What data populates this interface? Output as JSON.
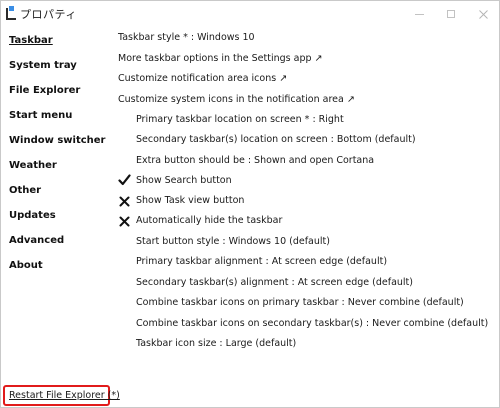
{
  "window": {
    "title": "プロパティ"
  },
  "sidebar": {
    "items": [
      {
        "label": "Taskbar",
        "active": true
      },
      {
        "label": "System tray"
      },
      {
        "label": "File Explorer"
      },
      {
        "label": "Start menu"
      },
      {
        "label": "Window switcher"
      },
      {
        "label": "Weather"
      },
      {
        "label": "Other"
      },
      {
        "label": "Updates"
      },
      {
        "label": "Advanced"
      },
      {
        "label": "About"
      }
    ],
    "restart_label": "Restart File Explorer (*)"
  },
  "settings": [
    {
      "label": "Taskbar style * : Windows 10",
      "kind": "option"
    },
    {
      "label": "More taskbar options in the Settings app ↗",
      "kind": "link"
    },
    {
      "label": "Customize notification area icons ↗",
      "kind": "link"
    },
    {
      "label": "Customize system icons in the notification area ↗",
      "kind": "link"
    },
    {
      "label": "Primary taskbar location on screen * : Right",
      "kind": "option"
    },
    {
      "label": "Secondary taskbar(s) location on screen : Bottom (default)",
      "kind": "option"
    },
    {
      "label": "Extra button should be : Shown and open Cortana",
      "kind": "option"
    },
    {
      "label": "Show Search button",
      "kind": "checkbox",
      "state": "checked"
    },
    {
      "label": "Show Task view button",
      "kind": "checkbox",
      "state": "unchecked"
    },
    {
      "label": "Automatically hide the taskbar",
      "kind": "checkbox",
      "state": "unchecked"
    },
    {
      "label": "Start button style : Windows 10 (default)",
      "kind": "option"
    },
    {
      "label": "Primary taskbar alignment : At screen edge (default)",
      "kind": "option"
    },
    {
      "label": "Secondary taskbar(s) alignment : At screen edge (default)",
      "kind": "option"
    },
    {
      "label": "Combine taskbar icons on primary taskbar : Never combine (default)",
      "kind": "option"
    },
    {
      "label": "Combine taskbar icons on secondary taskbar(s) : Never combine (default)",
      "kind": "option"
    },
    {
      "label": "Taskbar icon size : Large (default)",
      "kind": "option"
    }
  ]
}
